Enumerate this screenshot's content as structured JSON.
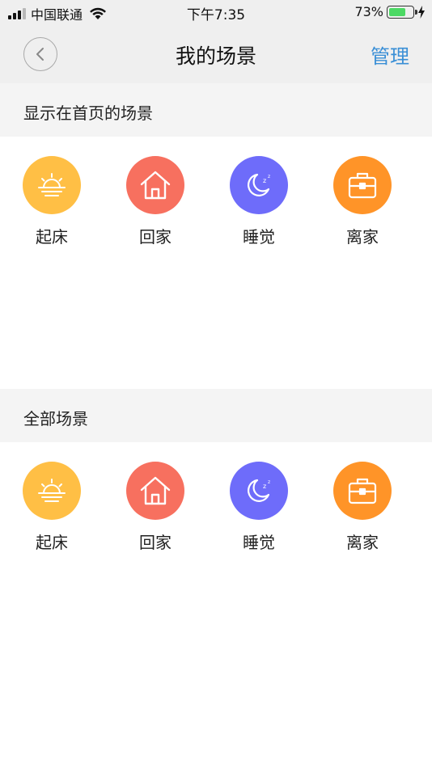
{
  "status_bar": {
    "carrier": "中国联通",
    "time": "下午7:35",
    "battery": "73%",
    "battery_level": 0.73
  },
  "nav": {
    "title": "我的场景",
    "action": "管理"
  },
  "sections": [
    {
      "title": "显示在首页的场景",
      "scenes": [
        {
          "label": "起床",
          "icon": "sunrise-icon",
          "color": "#ffbf45"
        },
        {
          "label": "回家",
          "icon": "house-icon",
          "color": "#f7705f"
        },
        {
          "label": "睡觉",
          "icon": "moon-icon",
          "color": "#6e6cfa"
        },
        {
          "label": "离家",
          "icon": "briefcase-icon",
          "color": "#ff9428"
        }
      ]
    },
    {
      "title": "全部场景",
      "scenes": [
        {
          "label": "起床",
          "icon": "sunrise-icon",
          "color": "#ffbf45"
        },
        {
          "label": "回家",
          "icon": "house-icon",
          "color": "#f7705f"
        },
        {
          "label": "睡觉",
          "icon": "moon-icon",
          "color": "#6e6cfa"
        },
        {
          "label": "离家",
          "icon": "briefcase-icon",
          "color": "#ff9428"
        }
      ]
    }
  ]
}
